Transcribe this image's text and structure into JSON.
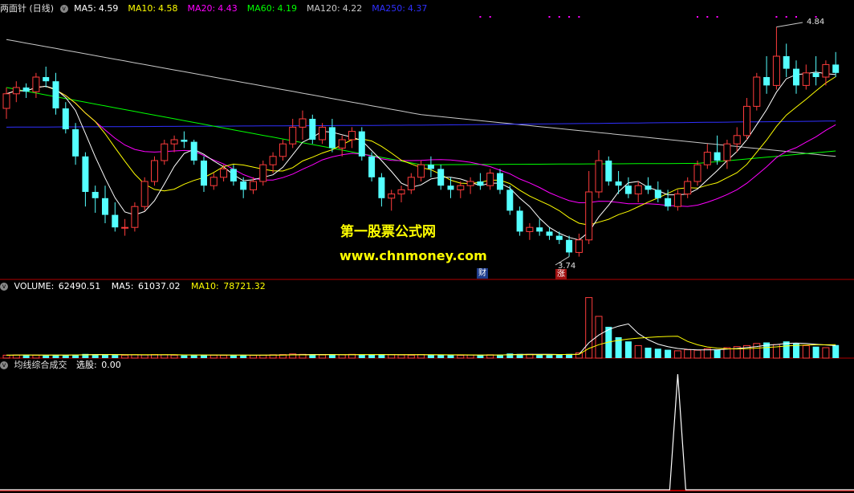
{
  "price_panel": {
    "title": "两面针 (日线)",
    "indicators": [
      {
        "label": "MA5:",
        "value": "4.59",
        "color": "#ffffff"
      },
      {
        "label": "MA10:",
        "value": "4.58",
        "color": "#ffff00"
      },
      {
        "label": "MA20:",
        "value": "4.43",
        "color": "#ff00ff"
      },
      {
        "label": "MA60:",
        "value": "4.19",
        "color": "#00ff00"
      },
      {
        "label": "MA120:",
        "value": "4.22",
        "color": "#c8c8c8"
      },
      {
        "label": "MA250:",
        "value": "4.37",
        "color": "#3030ff"
      }
    ],
    "high_label": "4.84",
    "low_label": "3.74",
    "event_tags": [
      "财",
      "涨"
    ]
  },
  "volume_panel": {
    "title": "VOLUME:",
    "value": "62490.51",
    "ma5_label": "MA5:",
    "ma5_value": "61037.02",
    "ma10_label": "MA10:",
    "ma10_value": "78721.32"
  },
  "indicator_panel": {
    "title": "均线综合成交",
    "signal_label": "选股:",
    "signal_value": "0.00"
  },
  "watermark": {
    "line1": "第一股票公式网",
    "line2": "www.chnmoney.com"
  },
  "colors": {
    "up": "#ff3c3c",
    "down": "#54ffff",
    "frame": "#b00000",
    "ma5": "#ffffff",
    "ma10": "#ffff00",
    "ma20": "#ff00ff",
    "ma60": "#00ff00",
    "ma120": "#c8c8c8",
    "ma250": "#3030ff"
  },
  "chart_data": {
    "type": "candlestick",
    "price_range_shown": [
      3.74,
      4.84
    ],
    "candles": [
      [
        4.45,
        4.55,
        4.4,
        4.52
      ],
      [
        4.52,
        4.58,
        4.48,
        4.55
      ],
      [
        4.55,
        4.57,
        4.5,
        4.53
      ],
      [
        4.53,
        4.62,
        4.5,
        4.6
      ],
      [
        4.6,
        4.65,
        4.55,
        4.58
      ],
      [
        4.58,
        4.62,
        4.42,
        4.45
      ],
      [
        4.45,
        4.48,
        4.33,
        4.35
      ],
      [
        4.35,
        4.38,
        4.18,
        4.22
      ],
      [
        4.22,
        4.24,
        3.98,
        4.05
      ],
      [
        4.05,
        4.08,
        3.95,
        4.02
      ],
      [
        4.02,
        4.08,
        3.9,
        3.94
      ],
      [
        3.94,
        4.0,
        3.86,
        3.88
      ],
      [
        3.88,
        3.92,
        3.84,
        3.88
      ],
      [
        3.88,
        4.0,
        3.86,
        3.98
      ],
      [
        3.98,
        4.12,
        3.96,
        4.1
      ],
      [
        4.1,
        4.22,
        4.08,
        4.2
      ],
      [
        4.2,
        4.3,
        4.18,
        4.28
      ],
      [
        4.28,
        4.32,
        4.24,
        4.3
      ],
      [
        4.3,
        4.34,
        4.26,
        4.29
      ],
      [
        4.29,
        4.3,
        4.18,
        4.2
      ],
      [
        4.2,
        4.22,
        4.05,
        4.08
      ],
      [
        4.08,
        4.14,
        4.06,
        4.12
      ],
      [
        4.12,
        4.18,
        4.1,
        4.16
      ],
      [
        4.16,
        4.18,
        4.08,
        4.1
      ],
      [
        4.1,
        4.12,
        4.02,
        4.06
      ],
      [
        4.06,
        4.12,
        4.04,
        4.1
      ],
      [
        4.1,
        4.2,
        4.08,
        4.18
      ],
      [
        4.18,
        4.24,
        4.14,
        4.22
      ],
      [
        4.22,
        4.3,
        4.2,
        4.28
      ],
      [
        4.28,
        4.4,
        4.26,
        4.36
      ],
      [
        4.36,
        4.44,
        4.3,
        4.4
      ],
      [
        4.4,
        4.42,
        4.28,
        4.3
      ],
      [
        4.3,
        4.38,
        4.28,
        4.36
      ],
      [
        4.36,
        4.4,
        4.24,
        4.26
      ],
      [
        4.26,
        4.32,
        4.22,
        4.3
      ],
      [
        4.3,
        4.36,
        4.26,
        4.34
      ],
      [
        4.34,
        4.36,
        4.2,
        4.22
      ],
      [
        4.22,
        4.24,
        4.1,
        4.12
      ],
      [
        4.12,
        4.14,
        3.98,
        4.02
      ],
      [
        4.02,
        4.06,
        3.96,
        4.04
      ],
      [
        4.04,
        4.08,
        4.0,
        4.06
      ],
      [
        4.06,
        4.14,
        4.04,
        4.12
      ],
      [
        4.12,
        4.2,
        4.1,
        4.18
      ],
      [
        4.18,
        4.22,
        4.12,
        4.16
      ],
      [
        4.16,
        4.18,
        4.06,
        4.08
      ],
      [
        4.08,
        4.12,
        4.02,
        4.06
      ],
      [
        4.06,
        4.1,
        4.02,
        4.08
      ],
      [
        4.08,
        4.12,
        4.04,
        4.1
      ],
      [
        4.1,
        4.14,
        4.06,
        4.08
      ],
      [
        4.08,
        4.16,
        4.06,
        4.14
      ],
      [
        4.14,
        4.16,
        4.04,
        4.06
      ],
      [
        4.06,
        4.08,
        3.94,
        3.96
      ],
      [
        3.96,
        3.98,
        3.84,
        3.86
      ],
      [
        3.86,
        3.9,
        3.82,
        3.88
      ],
      [
        3.88,
        3.92,
        3.84,
        3.86
      ],
      [
        3.86,
        3.88,
        3.82,
        3.84
      ],
      [
        3.84,
        3.86,
        3.8,
        3.82
      ],
      [
        3.82,
        3.84,
        3.74,
        3.76
      ],
      [
        3.76,
        3.85,
        3.74,
        3.82
      ],
      [
        3.82,
        4.15,
        3.8,
        4.05
      ],
      [
        4.05,
        4.25,
        4.02,
        4.2
      ],
      [
        4.2,
        4.22,
        4.08,
        4.1
      ],
      [
        4.1,
        4.15,
        4.04,
        4.08
      ],
      [
        4.08,
        4.12,
        4.02,
        4.04
      ],
      [
        4.04,
        4.1,
        4.0,
        4.08
      ],
      [
        4.08,
        4.12,
        4.04,
        4.06
      ],
      [
        4.06,
        4.1,
        4.0,
        4.02
      ],
      [
        4.02,
        4.06,
        3.96,
        3.98
      ],
      [
        3.98,
        4.06,
        3.96,
        4.04
      ],
      [
        4.04,
        4.12,
        4.02,
        4.1
      ],
      [
        4.1,
        4.2,
        4.08,
        4.18
      ],
      [
        4.18,
        4.28,
        4.16,
        4.24
      ],
      [
        4.24,
        4.32,
        4.18,
        4.2
      ],
      [
        4.2,
        4.3,
        4.16,
        4.28
      ],
      [
        4.28,
        4.36,
        4.24,
        4.32
      ],
      [
        4.32,
        4.5,
        4.3,
        4.46
      ],
      [
        4.46,
        4.62,
        4.44,
        4.6
      ],
      [
        4.6,
        4.7,
        4.52,
        4.56
      ],
      [
        4.56,
        4.84,
        4.54,
        4.7
      ],
      [
        4.7,
        4.76,
        4.6,
        4.64
      ],
      [
        4.64,
        4.68,
        4.52,
        4.56
      ],
      [
        4.56,
        4.66,
        4.54,
        4.62
      ],
      [
        4.62,
        4.7,
        4.56,
        4.6
      ],
      [
        4.6,
        4.68,
        4.56,
        4.66
      ],
      [
        4.66,
        4.72,
        4.6,
        4.62
      ]
    ],
    "volume_max": 300000,
    "volumes": [
      14000,
      15000,
      16000,
      14000,
      13000,
      16000,
      15000,
      17000,
      20000,
      18000,
      16000,
      15000,
      14000,
      16000,
      15000,
      17000,
      16000,
      14000,
      13000,
      15000,
      16000,
      14000,
      13000,
      14000,
      15000,
      13000,
      14000,
      16000,
      17000,
      20000,
      18000,
      16000,
      15000,
      17000,
      16000,
      18000,
      15000,
      17000,
      19000,
      16000,
      15000,
      14000,
      17000,
      16000,
      15000,
      14000,
      13000,
      15000,
      14000,
      16000,
      17000,
      22000,
      20000,
      18000,
      16000,
      15000,
      17000,
      20000,
      25000,
      290000,
      200000,
      150000,
      100000,
      80000,
      60000,
      50000,
      45000,
      40000,
      35000,
      40000,
      38000,
      45000,
      42000,
      50000,
      55000,
      60000,
      70000,
      75000,
      65000,
      80000,
      70000,
      60000,
      55000,
      50000,
      62490
    ],
    "signal": {
      "type": "spike",
      "peak_value": 1.0,
      "current_value": 0.0
    }
  }
}
